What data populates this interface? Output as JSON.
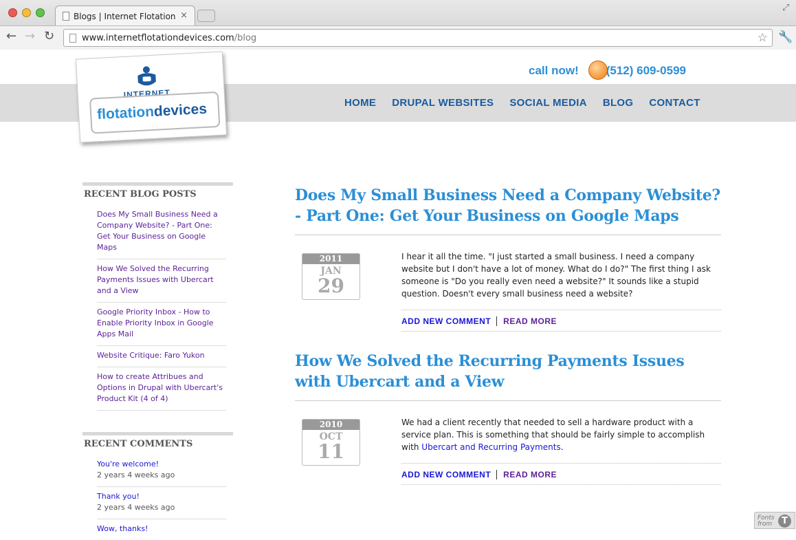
{
  "browser": {
    "tab_title": "Blogs | Internet Flotation Dev",
    "tab_close": "×",
    "url_host": "www.internetflotationdevices.com",
    "url_path": "/blog",
    "back": "←",
    "forward": "→",
    "reload": "↻",
    "star": "☆",
    "wrench": "🔧",
    "resize": "⤢"
  },
  "header": {
    "call_label": "call now!",
    "phone": "(512) 609-0599",
    "logo_internet": "INTERNET",
    "logo_flotation": "flotation",
    "logo_devices": "devices"
  },
  "nav": [
    "HOME",
    "DRUPAL WEBSITES",
    "SOCIAL MEDIA",
    "BLOG",
    "CONTACT"
  ],
  "sidebar": {
    "recent_posts_title": "RECENT BLOG POSTS",
    "recent_posts": [
      "Does My Small Business Need a Company Website? - Part One: Get Your Business on Google Maps",
      "How We Solved the Recurring Payments Issues with Ubercart and a View",
      "Google Priority Inbox - How to Enable Priority Inbox in Google Apps Mail",
      "Website Critique: Faro Yukon",
      "How to create Attribues and Options in Drupal with Ubercart's Product Kit (4 of 4)"
    ],
    "recent_comments_title": "RECENT COMMENTS",
    "recent_comments": [
      {
        "text": "You're welcome!",
        "ago": "2 years 4 weeks ago"
      },
      {
        "text": "Thank you!",
        "ago": "2 years 4 weeks ago"
      },
      {
        "text": "Wow, thanks!",
        "ago": ""
      }
    ]
  },
  "posts": [
    {
      "title": "Does My Small Business Need a Company Website? - Part One: Get Your Business on Google Maps",
      "year": "2011",
      "month": "JAN",
      "day": "29",
      "body": "I hear it all the time. \"I just started a small business. I need a company website but I don't have a lot of money. What do I do?\" The first thing I ask someone is \"Do you really even need a website?\"  It sounds like a stupid question.  Doesn't every small business need a website?",
      "body_link": "",
      "body_after": "",
      "add_comment": "ADD NEW COMMENT",
      "read_more": "READ MORE"
    },
    {
      "title": "How We Solved the Recurring Payments Issues with Ubercart and a View",
      "year": "2010",
      "month": "OCT",
      "day": "11",
      "body": "We had a client recently that needed to sell a hardware product with a service plan. This is something that should be fairly simple to accomplish with ",
      "body_link": "Ubercart and Recurring Payments",
      "body_after": ".",
      "add_comment": "ADD NEW COMMENT",
      "read_more": "READ MORE"
    }
  ],
  "fonts_badge": {
    "label": "Fonts from",
    "glyph": "T"
  }
}
